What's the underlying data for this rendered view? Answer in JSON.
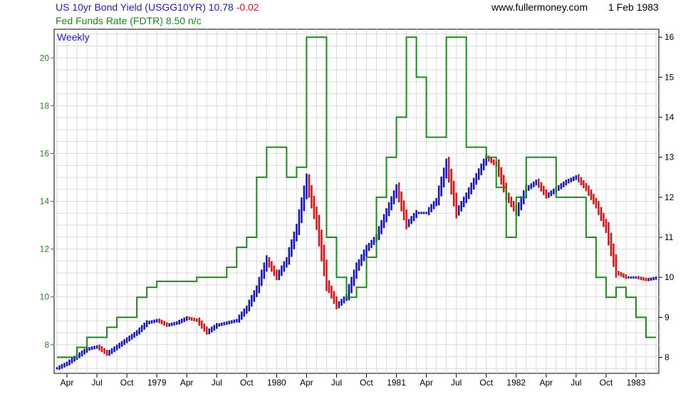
{
  "header": {
    "series1_label": "US 10yr Bond Yield (USGG10YR) 10.78",
    "series1_change": "-0.02",
    "series2_label": "Fed Funds Rate (FDTR) 8.50 n/c",
    "website": "www.fullermoney.com",
    "date": "1 Feb 1983"
  },
  "chart_data": {
    "type": "line",
    "frequency_label": "Weekly",
    "x_tick_labels": [
      "Apr",
      "Jul",
      "Oct",
      "1979",
      "Apr",
      "Jul",
      "Oct",
      "1980",
      "Apr",
      "Jul",
      "Oct",
      "1981",
      "Apr",
      "Jul",
      "Oct",
      "1982",
      "Apr",
      "Jul",
      "Oct",
      "1983"
    ],
    "x_range": [
      "1978-02",
      "1983-02"
    ],
    "left_axis": {
      "series": "US 10yr Bond Yield (USGG10YR)",
      "ylim": [
        6.8,
        21.2
      ],
      "ticks": [
        8,
        10,
        12,
        14,
        16,
        18,
        20
      ]
    },
    "right_axis": {
      "series": "Fed Funds Rate (FDTR)",
      "ylim": [
        7.6,
        16.2
      ],
      "ticks": [
        8,
        9,
        10,
        11,
        12,
        13,
        14,
        15,
        16
      ]
    },
    "grid": true,
    "colors": {
      "bond_up": "#1010d0",
      "bond_down": "#e01010",
      "fed_funds": "#1a8a1a",
      "grid": "#d9d9d9"
    },
    "series": [
      {
        "name": "US 10yr Bond Yield (USGG10YR)",
        "axis": "left",
        "x": [
          "1978-02",
          "1978-03",
          "1978-04",
          "1978-05",
          "1978-06",
          "1978-07",
          "1978-08",
          "1978-09",
          "1978-10",
          "1978-11",
          "1978-12",
          "1979-01",
          "1979-02",
          "1979-03",
          "1979-04",
          "1979-05",
          "1979-06",
          "1979-07",
          "1979-08",
          "1979-09",
          "1979-10",
          "1979-11",
          "1979-12",
          "1980-01",
          "1980-02",
          "1980-03",
          "1980-04",
          "1980-05",
          "1980-06",
          "1980-07",
          "1980-08",
          "1980-09",
          "1980-10",
          "1980-11",
          "1980-12",
          "1981-01",
          "1981-02",
          "1981-03",
          "1981-04",
          "1981-05",
          "1981-06",
          "1981-07",
          "1981-08",
          "1981-09",
          "1981-10",
          "1981-11",
          "1981-12",
          "1982-01",
          "1982-02",
          "1982-03",
          "1982-04",
          "1982-05",
          "1982-06",
          "1982-07",
          "1982-08",
          "1982-09",
          "1982-10",
          "1982-11",
          "1982-12",
          "1983-01",
          "1983-02"
        ],
        "values": [
          7.0,
          7.2,
          7.5,
          7.8,
          7.9,
          7.6,
          7.9,
          8.2,
          8.5,
          8.9,
          9.0,
          8.8,
          8.9,
          9.1,
          9.0,
          8.5,
          8.8,
          8.9,
          9.0,
          9.5,
          10.3,
          11.5,
          10.8,
          11.5,
          12.8,
          14.8,
          13.0,
          10.5,
          9.6,
          10.0,
          11.2,
          12.0,
          12.5,
          13.5,
          14.5,
          13.0,
          13.5,
          13.5,
          14.0,
          15.5,
          13.5,
          14.2,
          15.0,
          15.8,
          15.5,
          14.2,
          13.5,
          14.5,
          14.8,
          14.2,
          14.5,
          14.8,
          15.0,
          14.5,
          13.8,
          12.8,
          11.0,
          10.8,
          10.8,
          10.7,
          10.78
        ]
      },
      {
        "name": "Fed Funds Rate (FDTR)",
        "axis": "right",
        "x": [
          "1978-02",
          "1978-04",
          "1978-05",
          "1978-06",
          "1978-07",
          "1978-08",
          "1978-09",
          "1978-10",
          "1978-11",
          "1978-12",
          "1979-01",
          "1979-04",
          "1979-07",
          "1979-08",
          "1979-09",
          "1979-10",
          "1979-11",
          "1979-12",
          "1980-01",
          "1980-02",
          "1980-03",
          "1980-04",
          "1980-05",
          "1980-06",
          "1980-07",
          "1980-08",
          "1980-09",
          "1980-10",
          "1980-11",
          "1980-12",
          "1981-01",
          "1981-02",
          "1981-03",
          "1981-04",
          "1981-05",
          "1981-06",
          "1981-07",
          "1981-08",
          "1981-09",
          "1981-10",
          "1981-11",
          "1981-12",
          "1982-01",
          "1982-02",
          "1982-04",
          "1982-06",
          "1982-07",
          "1982-08",
          "1982-09",
          "1982-10",
          "1982-11",
          "1982-12",
          "1983-01",
          "1983-02"
        ],
        "values": [
          8.0,
          8.25,
          8.5,
          8.5,
          8.75,
          9.0,
          9.0,
          9.5,
          9.75,
          9.9,
          9.9,
          10.0,
          10.25,
          10.75,
          11.0,
          12.5,
          13.25,
          13.25,
          12.5,
          12.75,
          16.0,
          16.0,
          11.0,
          10.0,
          9.5,
          9.75,
          10.5,
          12.0,
          13.0,
          14.0,
          16.0,
          15.0,
          13.5,
          13.5,
          16.0,
          16.0,
          13.25,
          13.25,
          13.0,
          12.25,
          11.0,
          12.0,
          13.0,
          13.0,
          12.0,
          12.0,
          11.0,
          10.0,
          9.5,
          9.75,
          9.5,
          9.0,
          8.5,
          8.5
        ]
      }
    ]
  }
}
